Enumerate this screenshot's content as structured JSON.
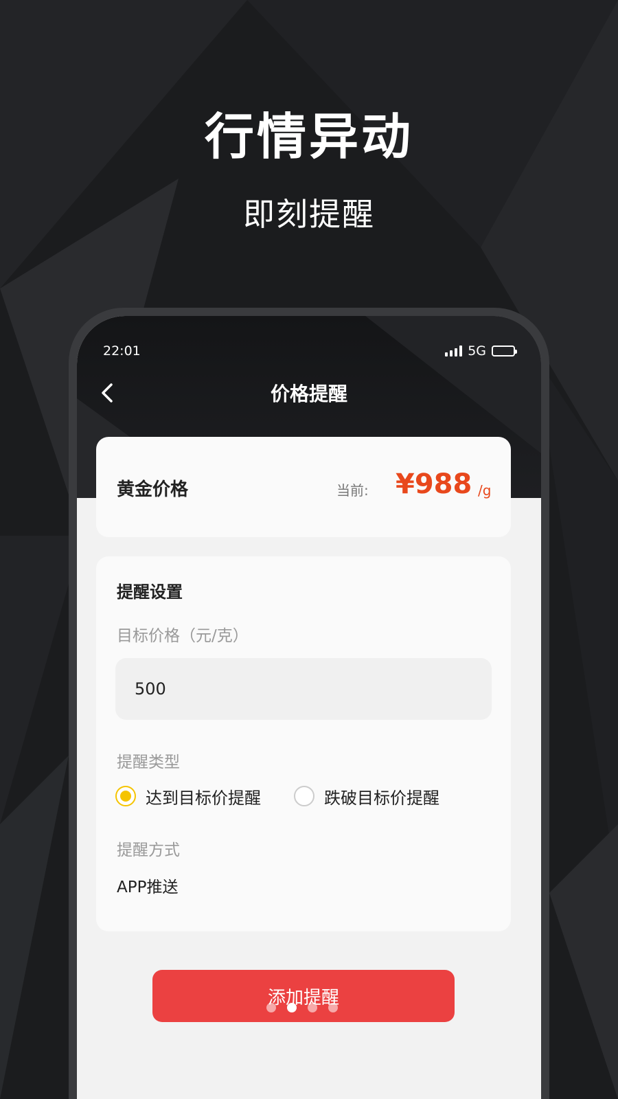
{
  "promo": {
    "headline": "行情异动",
    "subheadline": "即刻提醒"
  },
  "status_bar": {
    "time": "22:01",
    "network": "5G",
    "icons": [
      "signal-icon",
      "battery-icon"
    ]
  },
  "nav": {
    "back_icon": "chevron-left-icon",
    "title": "价格提醒"
  },
  "price_card": {
    "label": "黄金价格",
    "current_label": "当前:",
    "price": "¥988",
    "unit": "/g"
  },
  "settings": {
    "title": "提醒设置",
    "target_price_label": "目标价格（元/克）",
    "target_price_value": "500",
    "type_label": "提醒类型",
    "type_options": [
      {
        "label": "达到目标价提醒",
        "selected": true
      },
      {
        "label": "跌破目标价提醒",
        "selected": false
      }
    ],
    "method_label": "提醒方式",
    "method_value": "APP推送"
  },
  "actions": {
    "add_button": "添加提醒"
  },
  "carousel": {
    "total": 4,
    "active": 1
  },
  "colors": {
    "accent_price": "#e8481c",
    "button": "#eb4141",
    "radio_selected": "#f5c400",
    "background": "#1b1c1e"
  }
}
